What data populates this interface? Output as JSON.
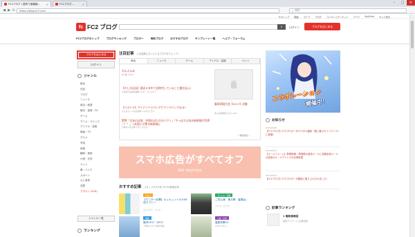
{
  "browser": {
    "tabs": [
      {
        "title": "FC2ブログ | 国内で高機能..."
      },
      {
        "title": "FC2ブログ..."
      }
    ],
    "url": "https://blog.fc2.com",
    "search_placeholder": "検索",
    "win_minimize": "–",
    "win_maximize": "□",
    "win_close": "✕",
    "nav_back": "◀",
    "nav_forward": "▶",
    "nav_reload": "↻"
  },
  "utilbar": {
    "links": [
      "FC2トップ",
      "動画",
      "ライブ",
      "ブログ",
      "コンテンツマーケット",
      "アプリ",
      "SayPoint",
      "もっと見る"
    ]
  },
  "header": {
    "logo_mark": "fc",
    "logo_text": "FC2 ブログ",
    "login": "ログイン",
    "start_blog": "ブログをはじめる"
  },
  "main_nav": [
    "FC2ブログのトップ",
    "ブログランキング",
    "ブロガー",
    "有料ブログ",
    "おすすめブログ",
    "テンプレート一覧",
    "ヘルプ・フォーラム"
  ],
  "sidebar": {
    "start_blog": "ブログをはじめる",
    "login": "ログイン",
    "genre_title": "ジャンル",
    "genres": [
      "総合",
      "日記",
      "ブログ",
      "ニュース",
      "政治・経済",
      "株式・投資・FX",
      "ゲーム",
      "アニメ・コミック",
      "アイドル・芸能",
      "映画・TV",
      "グルメ",
      "写真",
      "地域",
      "趣味・実用",
      "小説・文学",
      "ペット",
      "車・バイク",
      "スポーツ",
      "心と身体",
      "恋愛",
      "アダルト (R18)"
    ],
    "genre_more": "ジャンル一覧",
    "ranking_title": "ランキング"
  },
  "notice": {
    "title": "注目記事",
    "subtitle": "いま話題になっているブログをチェック！",
    "tabs": [
      "総合",
      "ニュース",
      "ゲーム",
      "アイドル・芸能",
      "ペット"
    ],
    "entries": [
      {
        "title": "わんぷんみ",
        "meta": "N仁姫 ブログ"
      },
      {
        "title": "【かしわ記念】過去６年中７回時代していること番位法(1)",
        "meta": "小田貢の競馬情報観ブログ - ガンメモー"
      },
      {
        "title": "【バズドラ】アイアンドラゴンアクアンペパンでなる?",
        "meta": "かんかんノミの読み物 in 2Cがブラウ"
      },
      {
        "title": "驚愕「日本のは地、中国のはただのパクリ」「やっぱり日本の新幹線が世界一！！」→外国人が驚き新幹線に",
        "meta": "日本の人気記事ブログ ネ子ロ... "
      }
    ],
    "right_title": "春季四国大会【2017】決勝",
    "right_meta": "香川高校野球ブログ 2017",
    "more": "一覧を見る ›"
  },
  "banner": {
    "text": "スマホ広告がすべてオフ",
    "logo": "FC2 ブログプラス"
  },
  "recommend": {
    "title": "おすすめ記事",
    "subtitle": "スタッフおすすめブログ&新着記事",
    "cards": [
      {
        "tag": "グルメ",
        "title": "【モニター記事】キュキュットCLEAR泡スプレー",
        "sub": "エブリデイ・パッケ..."
      },
      {
        "tag": "アイドル・芸能",
        "title": "ご宅公演　東方静　裏頭は...",
        "sub": "ジャスト ロック..."
      },
      {
        "tag": "地域",
        "title": "猫号2017（831）",
        "sub": "下関市ときどき観光協会"
      },
      {
        "tag": "小説・文学",
        "title": "霊能刑事10",
        "sub": "photo-story..."
      }
    ]
  },
  "right": {
    "ad_collab": "コラボレーション",
    "ad_kaisai": "開催中！",
    "news_title": "お知らせ",
    "news": [
      {
        "date": "2017/05/26",
        "text": "【FC2ブログ】FC2ブロガーがデジタル雑誌「猫と暮らすインテリア」に登場！"
      },
      {
        "date": "2017/05/25",
        "text": "【メールフォーム】新規投稿・再投稿の送信メールに自動返信メールの送信元メールアドレスの仕様変更"
      },
      {
        "date": "2017/05/24",
        "text": "【FC2ブログ】FC2ブロガーが雑誌に取り上げられました！"
      }
    ],
    "ranking_title": "記事ランキング",
    "rank_title": "1 猫和風毎回",
    "rank_sub": "最高アンケートご応募支援"
  },
  "colors": {
    "brand_red": "#e4322b",
    "banner_pink": "#f9c0b0",
    "tag_colors": [
      "#f5a623",
      "#27ae60",
      "#3498db",
      "#8e44ad"
    ]
  }
}
